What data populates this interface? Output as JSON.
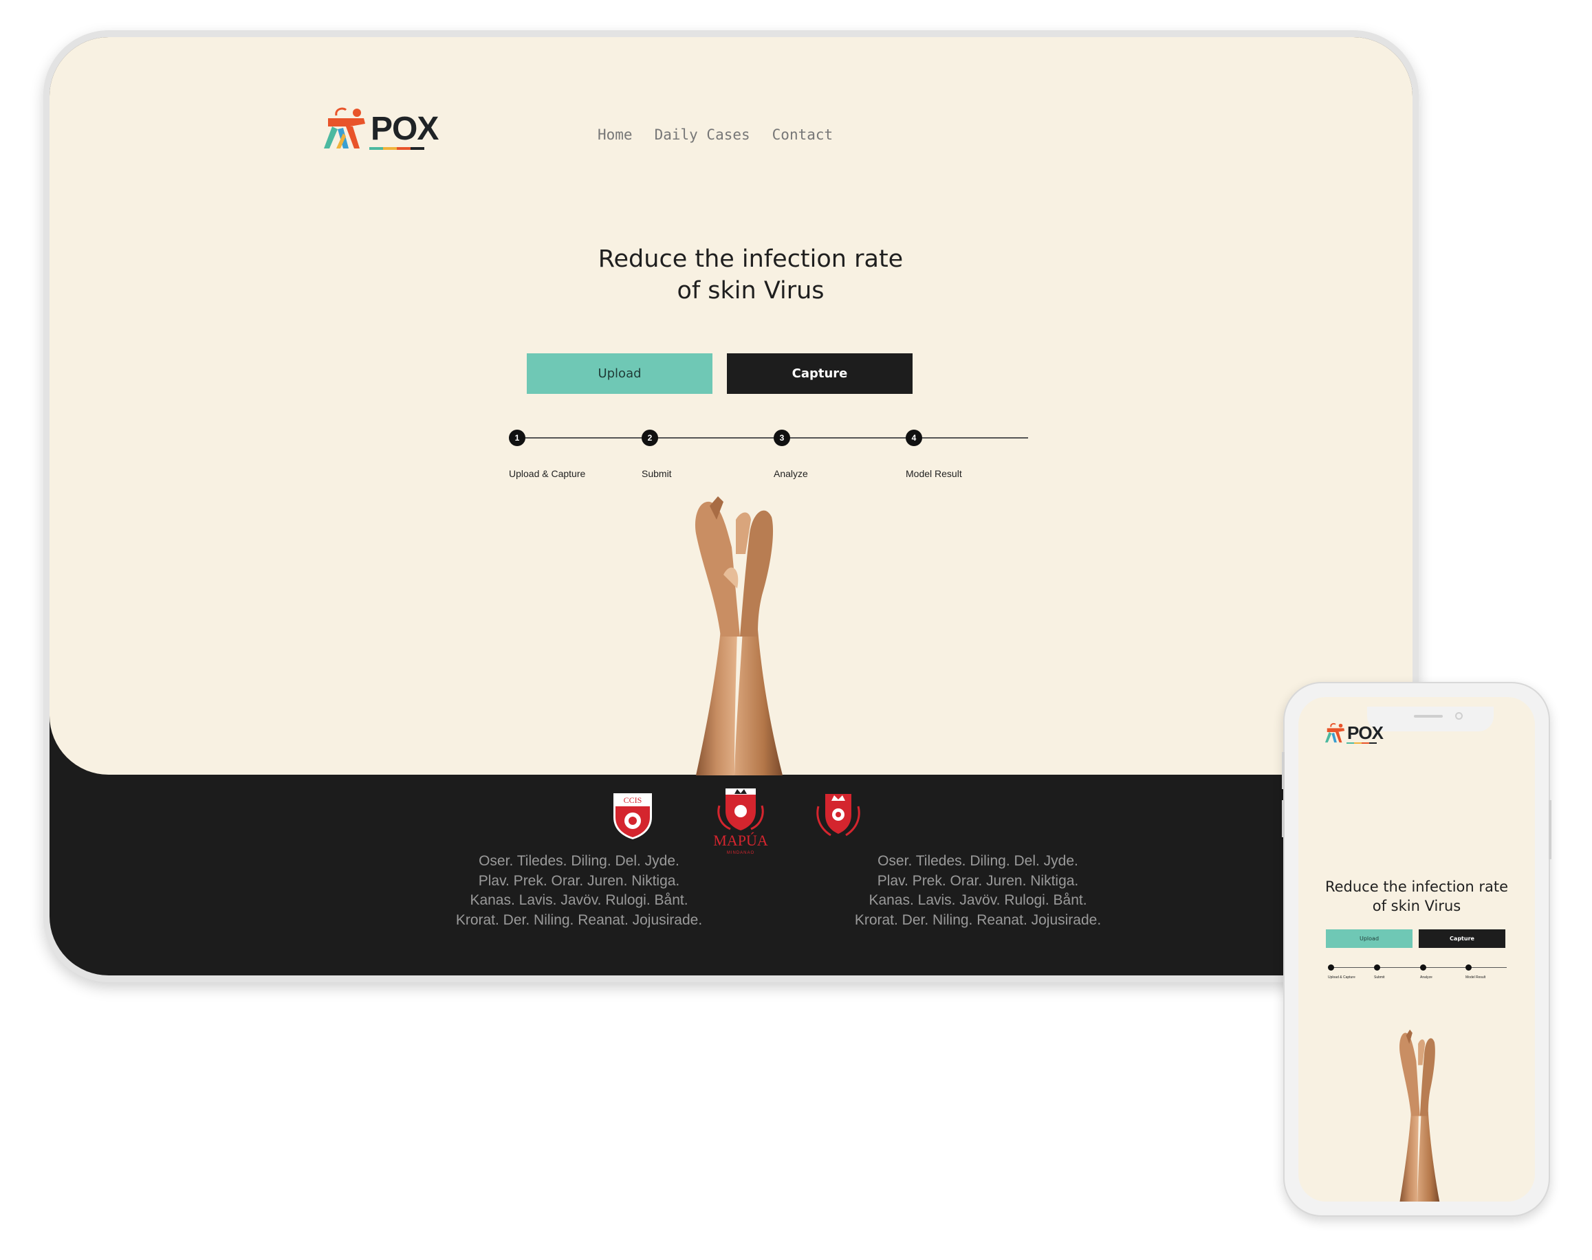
{
  "brand": {
    "name": "POX"
  },
  "nav": {
    "items": [
      "Home",
      "Daily Cases",
      "Contact"
    ]
  },
  "hero": {
    "headline_lines": [
      "Reduce the infection rate",
      "of  skin Virus"
    ],
    "upload_label": "Upload",
    "capture_label": "Capture"
  },
  "steps": [
    {
      "number": "1",
      "label": "Upload & Capture"
    },
    {
      "number": "2",
      "label": "Submit"
    },
    {
      "number": "3",
      "label": "Analyze"
    },
    {
      "number": "4",
      "label": "Model Result"
    }
  ],
  "footer": {
    "crests": [
      {
        "icon": "ccis-crest-icon",
        "text": "CCIS"
      },
      {
        "icon": "mapua-crest-icon",
        "text": "MAPÚA",
        "subtext": "MINDANAO"
      },
      {
        "icon": "mapua-shield-icon",
        "text": ""
      }
    ],
    "left_text": [
      "Oser. Tiledes. Diling. Del. Jyde.",
      "Plav. Prek. Orar. Juren. Niktiga.",
      "Kanas. Lavis. Javöv. Rulogi. Bånt.",
      "Krorat. Der. Niling. Reanat. Jojusirade."
    ],
    "right_text": [
      "Oser. Tiledes. Diling. Del. Jyde.",
      "Plav. Prek. Orar. Juren. Niktiga.",
      "Kanas. Lavis. Javöv. Rulogi. Bånt.",
      "Krorat. Der. Niling. Reanat. Jojusirade."
    ]
  },
  "colors": {
    "hero_bg": "#f8f1e2",
    "footer_bg": "#1c1c1c",
    "upload_button": "#6fc8b5",
    "capture_button": "#1d1d1d",
    "brand_orange": "#e8542a",
    "brand_teal": "#4cb9a0",
    "crest_red": "#d4252e"
  }
}
